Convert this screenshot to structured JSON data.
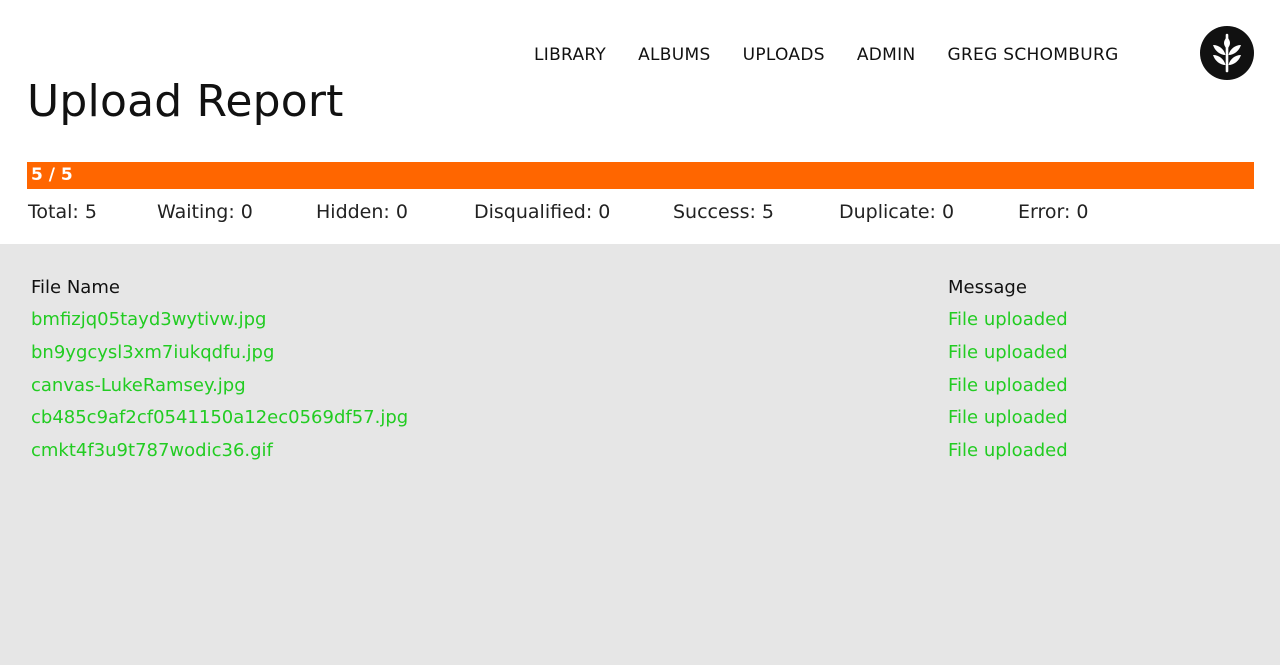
{
  "nav": {
    "items": [
      "LIBRARY",
      "ALBUMS",
      "UPLOADS",
      "ADMIN",
      "GREG SCHOMBURG"
    ],
    "logo_icon": "wheat-sprout-icon"
  },
  "page": {
    "title": "Upload Report"
  },
  "progress": {
    "label": "5 / 5",
    "completed": 5,
    "total": 5,
    "fraction": 1.0,
    "color": "#ff6600"
  },
  "stats": [
    {
      "label": "Total: 5"
    },
    {
      "label": "Waiting: 0"
    },
    {
      "label": "Hidden: 0"
    },
    {
      "label": "Disqualified: 0"
    },
    {
      "label": "Success: 5"
    },
    {
      "label": "Duplicate: 0"
    },
    {
      "label": "Error: 0"
    }
  ],
  "table": {
    "headers": {
      "file": "File Name",
      "message": "Message"
    },
    "row_color": "#22cc22",
    "rows": [
      {
        "file": "bmfizjq05tayd3wytivw.jpg",
        "message": "File uploaded"
      },
      {
        "file": "bn9ygcysl3xm7iukqdfu.jpg",
        "message": "File uploaded"
      },
      {
        "file": "canvas-LukeRamsey.jpg",
        "message": "File uploaded"
      },
      {
        "file": "cb485c9af2cf0541150a12ec0569df57.jpg",
        "message": "File uploaded"
      },
      {
        "file": "cmkt4f3u9t787wodic36.gif",
        "message": "File uploaded"
      }
    ]
  }
}
